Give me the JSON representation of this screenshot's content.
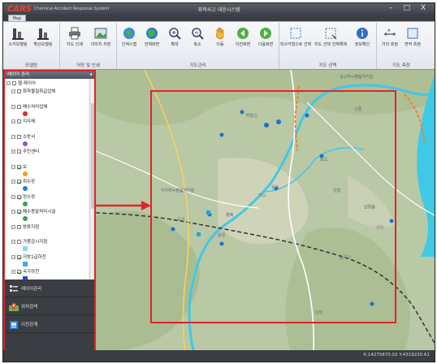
{
  "window": {
    "brand": "CARS",
    "brand_sub": "Chemical Accident Response System",
    "title": "화학사고 대응시스템",
    "controls": "– □ X",
    "file_tab": "Map"
  },
  "ribbon": {
    "groups": [
      {
        "label": "모델링",
        "buttons": [
          "소각모델링",
          "확산모델링"
        ]
      },
      {
        "label": "저장 및 인쇄",
        "buttons": [
          "지도 인쇄",
          "이미지 저장"
        ]
      },
      {
        "label": "지도관리",
        "buttons": [
          "인덱스맵",
          "전체화면",
          "확대",
          "축소",
          "이동",
          "이전화면",
          "다음화면"
        ]
      },
      {
        "label": "지도 선택",
        "buttons": [
          "직사각형으로 선택",
          "지도 선택 전체해제",
          "정보확인"
        ]
      },
      {
        "label": "지도 측정",
        "buttons": [
          "거리 측정",
          "면적 측정"
        ]
      }
    ]
  },
  "sidebar": {
    "header": "레이어 관리",
    "pin": "◂",
    "tree": [
      {
        "label": "웹 레이어",
        "level": 0,
        "checked": false,
        "symbol": ""
      },
      {
        "label": "화학물질취급업체",
        "level": 1,
        "checked": false,
        "symbol": ""
      },
      {
        "label": "폐수처리업체",
        "level": 1,
        "checked": false,
        "symbol": "#d62d20"
      },
      {
        "label": "지자체",
        "level": 1,
        "checked": false,
        "symbol": ""
      },
      {
        "label": "소방서",
        "level": 1,
        "checked": false,
        "symbol": "#9a4fd0"
      },
      {
        "label": "주민센터",
        "level": 1,
        "checked": false,
        "symbol": ""
      },
      {
        "label": "보",
        "level": 1,
        "checked": true,
        "symbol": "#f0a020"
      },
      {
        "label": "취수장",
        "level": 1,
        "checked": true,
        "symbol": "#1f7fd0"
      },
      {
        "label": "정수장",
        "level": 1,
        "checked": true,
        "symbol": "#31a84a"
      },
      {
        "label": "폐수종말처리시설",
        "level": 1,
        "checked": true,
        "symbol": "#31a84a"
      },
      {
        "label": "방류지점",
        "level": 1,
        "checked": false,
        "symbol": ""
      },
      {
        "label": "가뭄감시지점",
        "level": 1,
        "checked": false,
        "symbol": "#8ed6f0"
      },
      {
        "label": "지방1급하천",
        "level": 1,
        "checked": true,
        "symbol": "#4aa8e0"
      },
      {
        "label": "국가하천",
        "level": 1,
        "checked": true,
        "symbol": "#1a4fd6"
      }
    ],
    "buttons": [
      {
        "label": "레이어관리",
        "icon": "layers-icon"
      },
      {
        "label": "위치검색",
        "icon": "location-pin-icon"
      },
      {
        "label": "이전관계",
        "icon": "history-icon"
      }
    ]
  },
  "map": {
    "labels": [
      "성산하수종말처리장",
      "해평산",
      "구미하수종말처리장",
      "선산",
      "대신",
      "화조",
      "산동",
      "진평",
      "송정",
      "동복",
      "금오산",
      "구미",
      "도개",
      "남천",
      "남천읍"
    ],
    "highlight_color": "#e0242a",
    "river_color": "#3fc9e6"
  },
  "status": {
    "coords": "X:14275870.02 Y:4319220.61"
  }
}
